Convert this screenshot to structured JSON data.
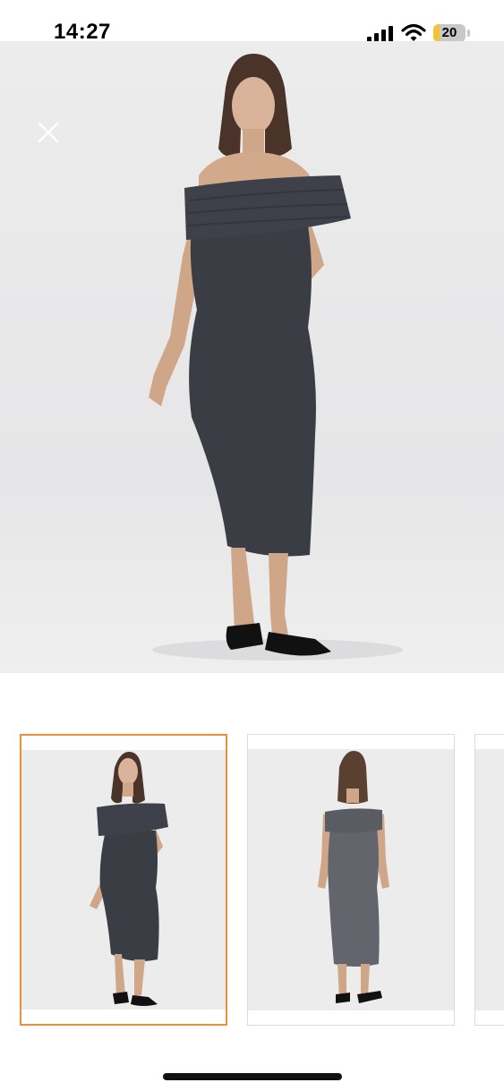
{
  "status_bar": {
    "time": "14:27",
    "battery_level": "20",
    "battery_fraction": 0.2,
    "battery_color": "#f4c430",
    "signal_icon": "cellular-signal-icon",
    "wifi_icon": "wifi-icon"
  },
  "viewer": {
    "close_icon": "close-icon",
    "dress_color": "#3b3d45",
    "selected_border_color": "#e8913a",
    "selected_index": 0,
    "thumbnails": [
      {
        "view": "front",
        "selected": true
      },
      {
        "view": "back",
        "selected": false
      },
      {
        "view": "side",
        "selected": false
      }
    ]
  }
}
